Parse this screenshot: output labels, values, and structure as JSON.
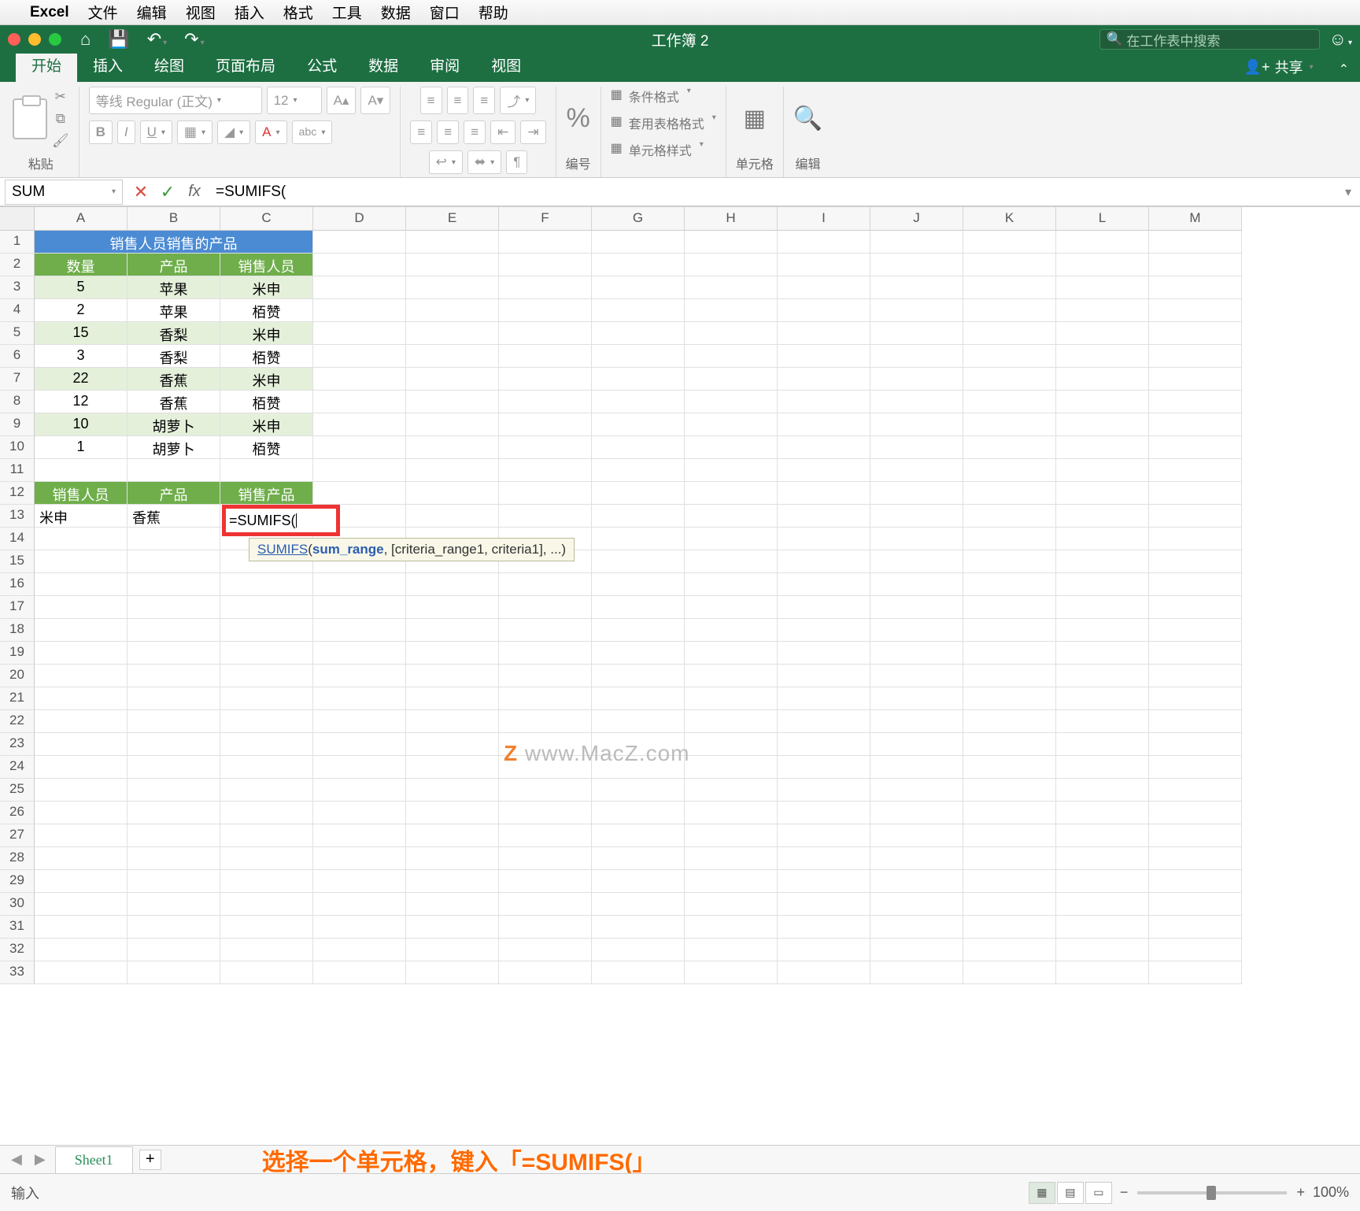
{
  "menubar": {
    "app": "Excel",
    "items": [
      "文件",
      "编辑",
      "视图",
      "插入",
      "格式",
      "工具",
      "数据",
      "窗口",
      "帮助"
    ]
  },
  "titlebar": {
    "doc": "工作簿 2",
    "search_placeholder": "在工作表中搜索"
  },
  "tabs": {
    "items": [
      "开始",
      "插入",
      "绘图",
      "页面布局",
      "公式",
      "数据",
      "审阅",
      "视图"
    ],
    "active": 0,
    "share": "共享"
  },
  "ribbon": {
    "paste": "粘贴",
    "font_name": "等线 Regular (正文)",
    "font_size": "12",
    "number": "编号",
    "cond": "条件格式",
    "fmt_table": "套用表格格式",
    "cell_style": "单元格样式",
    "cells": "单元格",
    "edit": "编辑"
  },
  "namebox": "SUM",
  "formula": "=SUMIFS(",
  "columns": [
    "A",
    "B",
    "C",
    "D",
    "E",
    "F",
    "G",
    "H",
    "I",
    "J",
    "K",
    "L",
    "M"
  ],
  "rows": 33,
  "table1": {
    "title": "销售人员销售的产品",
    "headers": [
      "数量",
      "产品",
      "销售人员"
    ],
    "rows": [
      [
        "5",
        "苹果",
        "米申"
      ],
      [
        "2",
        "苹果",
        "栢赞"
      ],
      [
        "15",
        "香梨",
        "米申"
      ],
      [
        "3",
        "香梨",
        "栢赞"
      ],
      [
        "22",
        "香蕉",
        "米申"
      ],
      [
        "12",
        "香蕉",
        "栢赞"
      ],
      [
        "10",
        "胡萝卜",
        "米申"
      ],
      [
        "1",
        "胡萝卜",
        "栢赞"
      ]
    ]
  },
  "table2": {
    "headers": [
      "销售人员",
      "产品",
      "销售产品"
    ],
    "row": [
      "米申",
      "香蕉",
      "=SUMIFS("
    ]
  },
  "tooltip": {
    "fn": "SUMIFS",
    "arg1": "sum_range",
    "rest": ", [criteria_range1, criteria1], ...)"
  },
  "sheet_tab": "Sheet1",
  "instruction": "选择一个单元格，键入「=SUMIFS(」",
  "status": {
    "mode": "输入",
    "zoom": "100%"
  },
  "watermark": "www.MacZ.com"
}
